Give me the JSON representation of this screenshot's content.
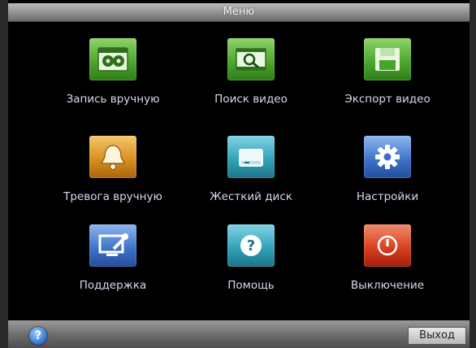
{
  "window": {
    "title": "Меню"
  },
  "menu": {
    "items": [
      {
        "label": "Запись вручную",
        "icon": "film-reel-icon"
      },
      {
        "label": "Поиск видео",
        "icon": "magnifier-film-icon"
      },
      {
        "label": "Экспорт видео",
        "icon": "floppy-disk-icon"
      },
      {
        "label": "Тревога вручную",
        "icon": "alarm-bell-icon"
      },
      {
        "label": "Жесткий диск",
        "icon": "hard-drive-icon"
      },
      {
        "label": "Настройки",
        "icon": "gear-icon"
      },
      {
        "label": "Поддержка",
        "icon": "monitor-wrench-icon"
      },
      {
        "label": "Помощь",
        "icon": "question-icon"
      },
      {
        "label": "Выключение",
        "icon": "power-icon"
      }
    ]
  },
  "statusbar": {
    "help_glyph": "?",
    "exit_label": "Выход"
  },
  "colors": {
    "green": "#4aa32b",
    "orange": "#d68c1c",
    "teal": "#2f9fb6",
    "blue": "#3b6fc7",
    "red": "#d43c1c"
  }
}
